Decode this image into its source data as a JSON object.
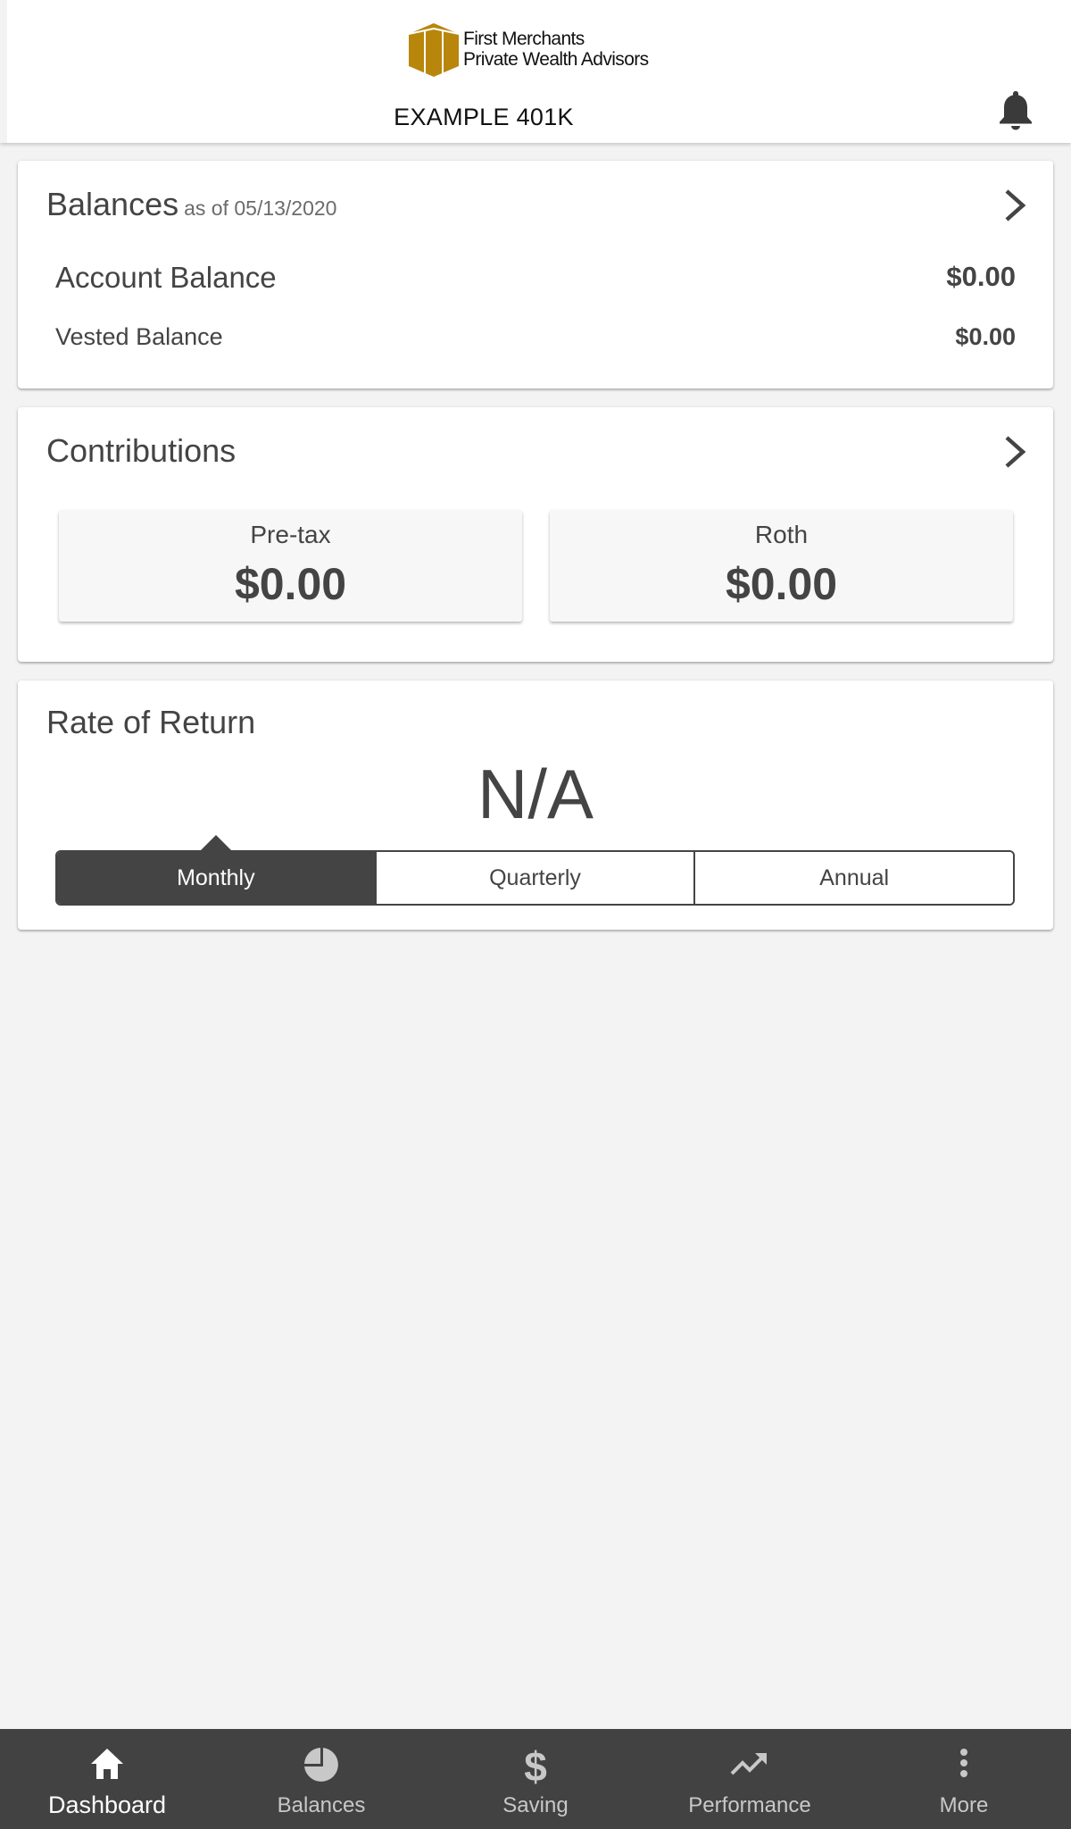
{
  "header": {
    "logo_line1": "First Merchants",
    "logo_line2": "Private Wealth Advisors",
    "title": "EXAMPLE 401K",
    "notification_icon": "bell-icon",
    "brand_color": "#b8860b"
  },
  "balances": {
    "title": "Balances",
    "as_of": "as of 05/13/2020",
    "rows": [
      {
        "label": "Account Balance",
        "value": "$0.00"
      },
      {
        "label": "Vested Balance",
        "value": "$0.00"
      }
    ]
  },
  "contributions": {
    "title": "Contributions",
    "items": [
      {
        "label": "Pre-tax",
        "value": "$0.00"
      },
      {
        "label": "Roth",
        "value": "$0.00"
      }
    ]
  },
  "rate_of_return": {
    "title": "Rate of Return",
    "value": "N/A",
    "periods": [
      {
        "label": "Monthly",
        "selected": true
      },
      {
        "label": "Quarterly",
        "selected": false
      },
      {
        "label": "Annual",
        "selected": false
      }
    ]
  },
  "bottom_nav": {
    "items": [
      {
        "label": "Dashboard",
        "icon": "home-icon",
        "active": true
      },
      {
        "label": "Balances",
        "icon": "pie-chart-icon",
        "active": false
      },
      {
        "label": "Saving",
        "icon": "dollar-icon",
        "active": false
      },
      {
        "label": "Performance",
        "icon": "trending-up-icon",
        "active": false
      },
      {
        "label": "More",
        "icon": "more-vertical-icon",
        "active": false
      }
    ]
  }
}
